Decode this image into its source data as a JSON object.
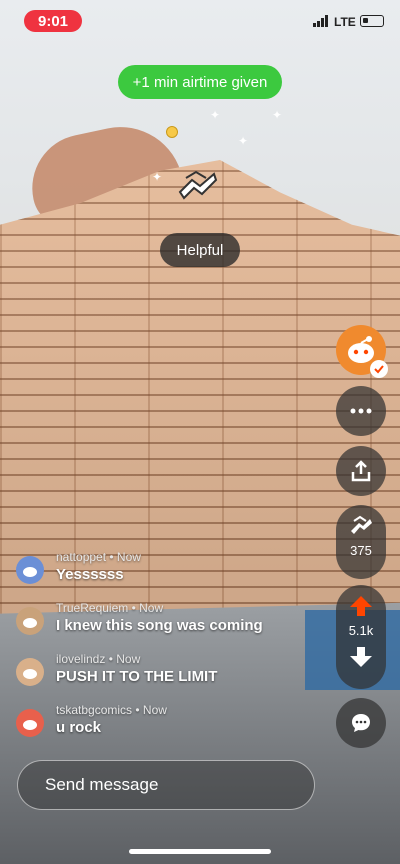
{
  "status_bar": {
    "time": "9:01",
    "network": "LTE"
  },
  "airtime_badge": {
    "label": "+1 min airtime given"
  },
  "award_popup": {
    "label": "Helpful"
  },
  "rail": {
    "award_count": "375",
    "vote_count": "5.1k"
  },
  "comments": [
    {
      "username": "nattoppet",
      "time": "Now",
      "text": "Yessssss",
      "avatar_color": "#6b8fd6"
    },
    {
      "username": "TrueRequiem",
      "time": "Now",
      "text": "I knew this song was coming",
      "avatar_color": "#c9a27a"
    },
    {
      "username": "ilovelindz",
      "time": "Now",
      "text": "PUSH IT TO THE LIMIT",
      "avatar_color": "#d9b08a"
    },
    {
      "username": "tskatbgcomics",
      "time": "Now",
      "text": "u rock",
      "avatar_color": "#e8604c"
    }
  ],
  "message_input": {
    "placeholder": "Send message"
  },
  "colors": {
    "time_pill": "#ef3340",
    "airtime_green": "#3cc93f",
    "upvote_orange": "#ff4500",
    "avatar_orange": "#f08a2e"
  },
  "icons": [
    "snoo-avatar-icon",
    "more-icon",
    "share-icon",
    "award-icon",
    "upvote-icon",
    "downvote-icon",
    "chat-icon"
  ]
}
